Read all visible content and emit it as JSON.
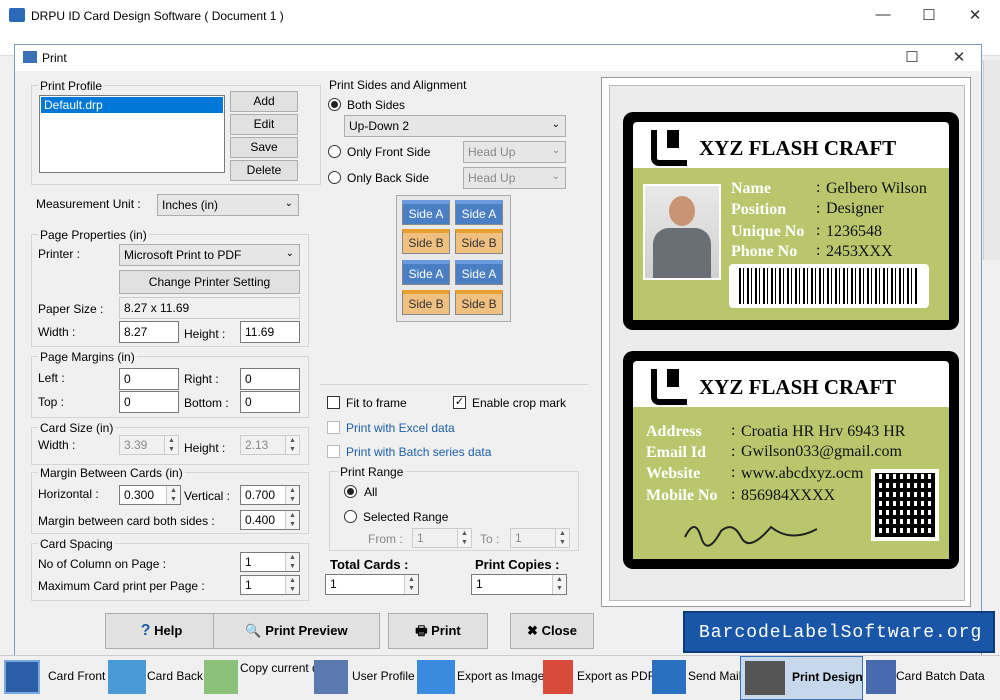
{
  "app": {
    "title": "DRPU ID Card Design Software ( Document 1 )",
    "min": "—",
    "max": "☐",
    "close": "✕"
  },
  "dialog": {
    "title": "Print",
    "max": "☐",
    "close": "✕"
  },
  "print_profile": {
    "label": "Print Profile",
    "items": [
      "Default.drp"
    ],
    "add": "Add",
    "edit": "Edit",
    "save": "Save",
    "delete": "Delete"
  },
  "measurement": {
    "label": "Measurement Unit :",
    "value": "Inches (in)"
  },
  "page_props": {
    "label": "Page Properties (in)",
    "printer_label": "Printer :",
    "printer": "Microsoft Print to PDF",
    "change_btn": "Change Printer Setting",
    "paper_label": "Paper Size :",
    "paper": "8.27 x 11.69",
    "width_label": "Width :",
    "width": "8.27",
    "height_label": "Height :",
    "height": "11.69"
  },
  "margins": {
    "label": "Page Margins (in)",
    "left_label": "Left :",
    "left": "0",
    "right_label": "Right :",
    "right": "0",
    "top_label": "Top :",
    "top": "0",
    "bottom_label": "Bottom :",
    "bottom": "0"
  },
  "card_size": {
    "label": "Card Size (in)",
    "width_label": "Width :",
    "width": "3.39",
    "height_label": "Height :",
    "height": "2.13"
  },
  "between": {
    "label": "Margin Between Cards (in)",
    "h_label": "Horizontal :",
    "h": "0.300",
    "v_label": "Vertical :",
    "v": "0.700",
    "both_label": "Margin between card both sides :",
    "both": "0.400"
  },
  "spacing": {
    "label": "Card Spacing",
    "cols_label": "No of Column on Page :",
    "cols": "1",
    "max_label": "Maximum Card print per Page :",
    "max": "1"
  },
  "sides": {
    "label": "Print Sides and Alignment",
    "both": "Both Sides",
    "updown": "Up-Down 2",
    "front": "Only Front Side",
    "back": "Only Back Side",
    "headup1": "Head Up",
    "headup2": "Head Up",
    "side_a": "Side A",
    "side_b": "Side B"
  },
  "options": {
    "fit": "Fit to frame",
    "crop": "Enable crop mark",
    "excel": "Print with Excel data",
    "batch": "Print with Batch series data"
  },
  "range": {
    "label": "Print Range",
    "all": "All",
    "selected": "Selected Range",
    "from_label": "From :",
    "from": "1",
    "to_label": "To :",
    "to": "1"
  },
  "totals": {
    "total_label": "Total Cards :",
    "total": "1",
    "copies_label": "Print Copies :",
    "copies": "1"
  },
  "buttons": {
    "help": "Help",
    "preview": "Print Preview",
    "print": "Print",
    "close": "Close"
  },
  "brand": "BarcodeLabelSoftware.org",
  "card_front": {
    "company": "XYZ FLASH CRAFT",
    "name_label": "Name",
    "name": "Gelbero Wilson",
    "position_label": "Position",
    "position": "Designer",
    "unique_label": "Unique No",
    "unique": "1236548",
    "phone_label": "Phone No",
    "phone": "2453XXX"
  },
  "card_back": {
    "company": "XYZ FLASH CRAFT",
    "address_label": "Address",
    "address": "Croatia HR Hrv 6943 HR",
    "email_label": "Email Id",
    "email": "Gwilson033@gmail.com",
    "website_label": "Website",
    "website": "www.abcdxyz.ocm",
    "mobile_label": "Mobile No",
    "mobile": "856984XXXX"
  },
  "colon": ":",
  "toolbar": [
    "Card Front",
    "Card Back",
    "Copy current design",
    "User Profile",
    "Export as Image",
    "Export as PDF",
    "Send Mail",
    "Print Design",
    "Card Batch Data"
  ],
  "colors": {
    "card_green": "#b9c66c",
    "brand_bg": "#1a56a8",
    "dialog_border": "#7a9cc6"
  }
}
